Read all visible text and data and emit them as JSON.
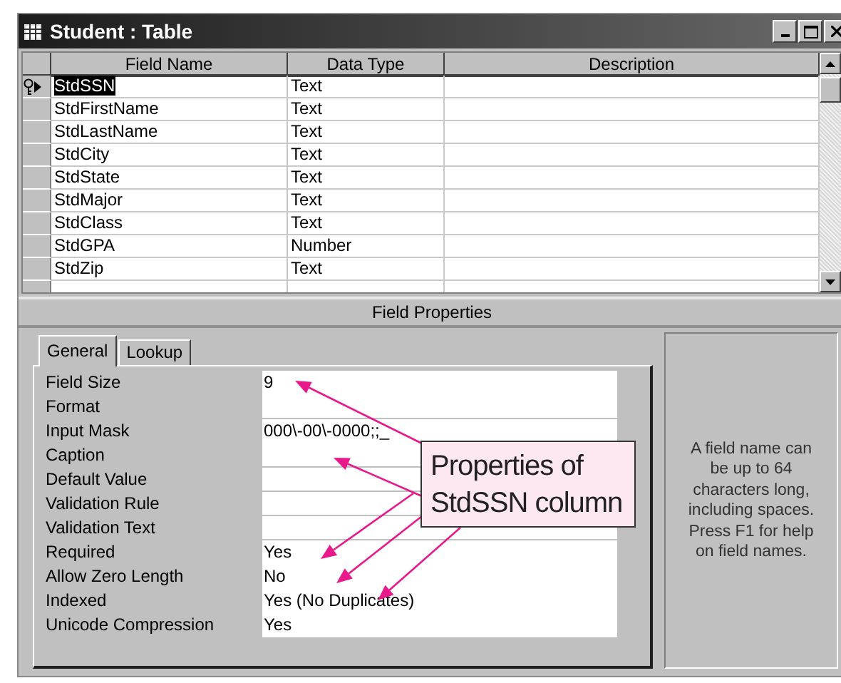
{
  "window": {
    "title": "Student : Table"
  },
  "table": {
    "columns": [
      "Field Name",
      "Data Type",
      "Description"
    ],
    "rows": [
      {
        "field_name": "StdSSN",
        "data_type": "Text",
        "selected": true,
        "primary_key": true
      },
      {
        "field_name": "StdFirstName",
        "data_type": "Text",
        "selected": false,
        "primary_key": false
      },
      {
        "field_name": "StdLastName",
        "data_type": "Text",
        "selected": false,
        "primary_key": false
      },
      {
        "field_name": "StdCity",
        "data_type": "Text",
        "selected": false,
        "primary_key": false
      },
      {
        "field_name": "StdState",
        "data_type": "Text",
        "selected": false,
        "primary_key": false
      },
      {
        "field_name": "StdMajor",
        "data_type": "Text",
        "selected": false,
        "primary_key": false
      },
      {
        "field_name": "StdClass",
        "data_type": "Text",
        "selected": false,
        "primary_key": false
      },
      {
        "field_name": "StdGPA",
        "data_type": "Number",
        "selected": false,
        "primary_key": false
      },
      {
        "field_name": "StdZip",
        "data_type": "Text",
        "selected": false,
        "primary_key": false
      }
    ]
  },
  "field_properties": {
    "title": "Field Properties",
    "tabs": [
      {
        "label": "General",
        "selected": true
      },
      {
        "label": "Lookup",
        "selected": false
      }
    ],
    "properties": [
      {
        "label": "Field Size",
        "value": "9"
      },
      {
        "label": "Format"
      },
      {
        "label": "Input Mask",
        "value": "000\\-00\\-0000;;_"
      },
      {
        "label": "Caption"
      },
      {
        "label": "Default Value"
      },
      {
        "label": "Validation Rule"
      },
      {
        "label": "Validation Text"
      },
      {
        "label": "Required",
        "value": "Yes"
      },
      {
        "label": "Allow Zero Length",
        "value": "No"
      },
      {
        "label": "Indexed",
        "value": "Yes (No Duplicates)"
      },
      {
        "label": "Unicode Compression",
        "value": "Yes"
      }
    ],
    "help": "A field name can be up to 64 characters long, including spaces. Press F1 for help on field names."
  },
  "callout": {
    "text": "Properties of StdSSN column"
  }
}
